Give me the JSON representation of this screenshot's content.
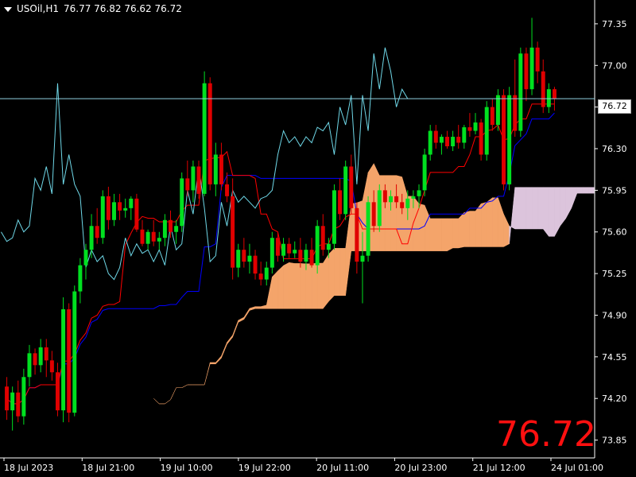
{
  "header": {
    "symbol_tf": "USOil,H1",
    "ohlc": "76.77 76.82 76.62 76.72"
  },
  "current_price": "76.72",
  "big_price": "76.72",
  "chart_data": {
    "type": "candlestick",
    "ylim": [
      73.7,
      77.55
    ],
    "y_ticks": [
      "77.35",
      "77.00",
      "76.65",
      "76.30",
      "75.95",
      "75.60",
      "75.25",
      "74.90",
      "74.55",
      "74.20",
      "73.85"
    ],
    "x_ticks": [
      "18 Jul 2023",
      "18 Jul 21:00",
      "19 Jul 10:00",
      "19 Jul 22:00",
      "20 Jul 11:00",
      "20 Jul 23:00",
      "21 Jul 12:00",
      "24 Jul 01:00"
    ],
    "colors": {
      "background": "#000000",
      "bull": "#00e020",
      "bear": "#e00000",
      "tenkan": "#ff0000",
      "kijun": "#0000ff",
      "chikou": "#6fd8e8",
      "cloud_bull": "#f4a46a",
      "cloud_bear": "#dcc4dc",
      "current_line": "#8fcfe0",
      "big_price": "#ff1010"
    },
    "candles": [
      [
        74.3,
        74.38,
        74.02,
        74.1
      ],
      [
        74.1,
        74.3,
        73.93,
        74.25
      ],
      [
        74.25,
        74.35,
        74.0,
        74.05
      ],
      [
        74.05,
        74.45,
        73.98,
        74.38
      ],
      [
        74.38,
        74.65,
        74.3,
        74.58
      ],
      [
        74.58,
        74.62,
        74.4,
        74.48
      ],
      [
        74.48,
        74.7,
        74.42,
        74.63
      ],
      [
        74.63,
        74.7,
        74.38,
        74.52
      ],
      [
        74.52,
        74.6,
        74.35,
        74.42
      ],
      [
        74.42,
        74.5,
        74.05,
        74.1
      ],
      [
        74.1,
        75.05,
        74.0,
        74.95
      ],
      [
        74.95,
        75.0,
        74.0,
        74.08
      ],
      [
        74.08,
        75.15,
        74.05,
        75.1
      ],
      [
        75.1,
        75.38,
        75.0,
        75.32
      ],
      [
        75.32,
        75.5,
        75.2,
        75.45
      ],
      [
        75.45,
        75.75,
        75.38,
        75.65
      ],
      [
        75.65,
        75.8,
        75.5,
        75.55
      ],
      [
        75.55,
        75.95,
        75.5,
        75.9
      ],
      [
        75.9,
        75.98,
        75.62,
        75.7
      ],
      [
        75.7,
        75.92,
        75.65,
        75.85
      ],
      [
        75.85,
        75.92,
        75.7,
        75.78
      ],
      [
        75.78,
        75.88,
        75.72,
        75.8
      ],
      [
        75.8,
        75.9,
        75.7,
        75.88
      ],
      [
        75.88,
        75.92,
        75.6,
        75.62
      ],
      [
        75.62,
        75.7,
        75.48,
        75.5
      ],
      [
        75.5,
        75.62,
        75.45,
        75.6
      ],
      [
        75.6,
        75.7,
        75.48,
        75.52
      ],
      [
        75.52,
        75.6,
        75.45,
        75.55
      ],
      [
        75.55,
        75.75,
        75.48,
        75.7
      ],
      [
        75.7,
        75.78,
        75.55,
        75.6
      ],
      [
        75.6,
        75.7,
        75.5,
        75.65
      ],
      [
        75.65,
        76.1,
        75.6,
        76.05
      ],
      [
        76.05,
        76.2,
        75.9,
        75.95
      ],
      [
        75.95,
        76.2,
        75.85,
        76.15
      ],
      [
        76.15,
        76.2,
        75.88,
        75.92
      ],
      [
        75.92,
        76.95,
        75.9,
        76.85
      ],
      [
        76.85,
        76.9,
        75.95,
        76.0
      ],
      [
        76.0,
        76.35,
        75.9,
        76.25
      ],
      [
        76.25,
        76.35,
        75.95,
        76.0
      ],
      [
        76.0,
        76.1,
        75.85,
        75.9
      ],
      [
        75.9,
        76.05,
        75.2,
        75.3
      ],
      [
        75.3,
        75.5,
        75.22,
        75.45
      ],
      [
        75.45,
        75.55,
        75.3,
        75.35
      ],
      [
        75.35,
        75.5,
        75.25,
        75.4
      ],
      [
        75.4,
        75.45,
        75.2,
        75.25
      ],
      [
        75.25,
        75.35,
        75.15,
        75.2
      ],
      [
        75.2,
        75.35,
        75.15,
        75.3
      ],
      [
        75.3,
        75.6,
        75.25,
        75.55
      ],
      [
        75.55,
        75.6,
        75.35,
        75.4
      ],
      [
        75.4,
        75.55,
        75.35,
        75.5
      ],
      [
        75.5,
        75.55,
        75.38,
        75.42
      ],
      [
        75.42,
        75.52,
        75.38,
        75.45
      ],
      [
        75.45,
        75.55,
        75.3,
        75.35
      ],
      [
        75.35,
        75.5,
        75.28,
        75.45
      ],
      [
        75.45,
        75.55,
        75.3,
        75.32
      ],
      [
        75.32,
        75.7,
        75.25,
        75.65
      ],
      [
        75.65,
        75.75,
        75.4,
        75.45
      ],
      [
        75.45,
        75.55,
        75.38,
        75.5
      ],
      [
        75.5,
        76.0,
        75.45,
        75.95
      ],
      [
        75.95,
        76.05,
        75.7,
        75.75
      ],
      [
        75.75,
        76.2,
        75.7,
        76.15
      ],
      [
        76.15,
        76.25,
        75.75,
        75.8
      ],
      [
        75.8,
        75.85,
        75.25,
        75.35
      ],
      [
        75.35,
        75.6,
        75.0,
        75.4
      ],
      [
        75.4,
        75.9,
        75.35,
        75.85
      ],
      [
        75.85,
        75.95,
        75.6,
        75.65
      ],
      [
        75.65,
        76.0,
        75.6,
        75.95
      ],
      [
        75.95,
        76.0,
        75.8,
        75.85
      ],
      [
        75.85,
        75.95,
        75.78,
        75.9
      ],
      [
        75.9,
        76.0,
        75.8,
        75.85
      ],
      [
        75.85,
        75.92,
        75.75,
        75.8
      ],
      [
        75.8,
        75.95,
        75.7,
        75.88
      ],
      [
        75.88,
        75.95,
        75.8,
        75.9
      ],
      [
        75.9,
        76.0,
        75.8,
        75.95
      ],
      [
        75.95,
        76.3,
        75.9,
        76.25
      ],
      [
        76.25,
        76.5,
        76.2,
        76.45
      ],
      [
        76.45,
        76.5,
        76.3,
        76.35
      ],
      [
        76.35,
        76.42,
        76.25,
        76.4
      ],
      [
        76.4,
        76.45,
        76.3,
        76.32
      ],
      [
        76.32,
        76.45,
        76.28,
        76.4
      ],
      [
        76.4,
        76.5,
        76.3,
        76.35
      ],
      [
        76.35,
        76.5,
        76.3,
        76.48
      ],
      [
        76.48,
        76.6,
        76.4,
        76.45
      ],
      [
        76.45,
        76.6,
        76.42,
        76.52
      ],
      [
        76.52,
        76.55,
        76.2,
        76.25
      ],
      [
        76.25,
        76.7,
        76.2,
        76.65
      ],
      [
        76.65,
        76.72,
        76.45,
        76.5
      ],
      [
        76.5,
        76.8,
        76.45,
        76.75
      ],
      [
        76.75,
        76.8,
        75.95,
        76.0
      ],
      [
        76.0,
        76.82,
        75.95,
        76.75
      ],
      [
        76.75,
        77.05,
        76.4,
        76.45
      ],
      [
        76.45,
        77.15,
        76.4,
        77.1
      ],
      [
        77.1,
        77.15,
        76.7,
        76.8
      ],
      [
        76.8,
        77.4,
        76.75,
        77.15
      ],
      [
        77.15,
        77.2,
        76.85,
        76.95
      ],
      [
        76.95,
        77.05,
        76.6,
        76.65
      ],
      [
        76.65,
        76.85,
        76.6,
        76.8
      ],
      [
        76.8,
        76.82,
        76.62,
        76.72
      ]
    ]
  }
}
